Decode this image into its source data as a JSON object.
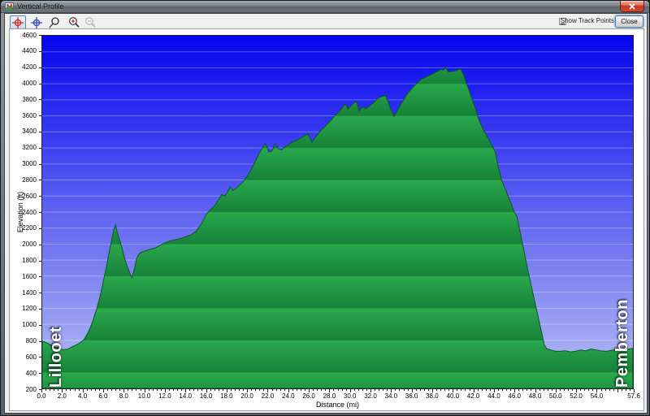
{
  "window": {
    "title": "Vertical Profile"
  },
  "icons": {
    "window_close_glyph": "x",
    "toolbar": [
      {
        "name": "track-pan-red-icon",
        "selected": true,
        "enabled": true
      },
      {
        "name": "track-pan-blue-icon",
        "selected": false,
        "enabled": true
      },
      {
        "name": "lasso-select-icon",
        "selected": false,
        "enabled": true
      },
      {
        "name": "zoom-in-icon",
        "selected": false,
        "enabled": true
      },
      {
        "name": "zoom-out-icon",
        "selected": false,
        "enabled": false
      }
    ]
  },
  "controls": {
    "show_track_points_prefix": "S",
    "show_track_points_rest": "how Track Points",
    "show_track_points_checked": false,
    "close_label": "Close"
  },
  "chart_data": {
    "type": "area",
    "xlabel": "Distance  (mi)",
    "ylabel": "Elevation (ft)",
    "xlim": [
      0,
      57.6
    ],
    "ylim": [
      200,
      4600
    ],
    "x_tick_step": 2.0,
    "x_minor_tick_step": 0.4,
    "x_final_tick": 57.6,
    "x_skipped_tick_labels": [
      56.0
    ],
    "y_tick_step": 200,
    "grid": "horizontal-only",
    "start_label": "Lillooet",
    "end_label": "Pemberton",
    "colors": {
      "sky_top": "#0505f0",
      "sky_bottom": "#b9c1f3",
      "gridline": "rgba(255,255,255,0.32)",
      "terrain_light": "#2aa94c",
      "terrain_dark": "#178139",
      "terrain_outline": "#0d5624",
      "band_height_ft": 400
    },
    "series": [
      {
        "name": "elevation_profile",
        "points": [
          [
            0.0,
            790
          ],
          [
            0.4,
            770
          ],
          [
            0.8,
            745
          ],
          [
            1.2,
            720
          ],
          [
            1.6,
            700
          ],
          [
            2.0,
            682
          ],
          [
            2.4,
            688
          ],
          [
            2.8,
            710
          ],
          [
            3.2,
            735
          ],
          [
            3.6,
            762
          ],
          [
            3.9,
            790
          ],
          [
            4.1,
            815
          ],
          [
            4.4,
            880
          ],
          [
            4.7,
            960
          ],
          [
            5.0,
            1070
          ],
          [
            5.3,
            1190
          ],
          [
            5.6,
            1330
          ],
          [
            5.9,
            1500
          ],
          [
            6.2,
            1690
          ],
          [
            6.5,
            1880
          ],
          [
            6.8,
            2070
          ],
          [
            7.0,
            2190
          ],
          [
            7.15,
            2245
          ],
          [
            7.3,
            2150
          ],
          [
            7.6,
            2030
          ],
          [
            7.9,
            1890
          ],
          [
            8.2,
            1750
          ],
          [
            8.5,
            1650
          ],
          [
            8.75,
            1585
          ],
          [
            9.0,
            1700
          ],
          [
            9.2,
            1820
          ],
          [
            9.45,
            1880
          ],
          [
            9.7,
            1900
          ],
          [
            10.0,
            1915
          ],
          [
            10.5,
            1935
          ],
          [
            11.0,
            1950
          ],
          [
            11.5,
            1985
          ],
          [
            12.0,
            2020
          ],
          [
            12.5,
            2040
          ],
          [
            13.0,
            2055
          ],
          [
            13.5,
            2070
          ],
          [
            14.0,
            2095
          ],
          [
            14.5,
            2115
          ],
          [
            15.0,
            2160
          ],
          [
            15.5,
            2250
          ],
          [
            16.0,
            2370
          ],
          [
            16.4,
            2430
          ],
          [
            16.8,
            2475
          ],
          [
            17.2,
            2555
          ],
          [
            17.5,
            2620
          ],
          [
            17.8,
            2600
          ],
          [
            18.1,
            2660
          ],
          [
            18.35,
            2715
          ],
          [
            18.6,
            2670
          ],
          [
            18.9,
            2695
          ],
          [
            19.2,
            2730
          ],
          [
            19.6,
            2780
          ],
          [
            20.0,
            2850
          ],
          [
            20.4,
            2935
          ],
          [
            20.8,
            3040
          ],
          [
            21.2,
            3140
          ],
          [
            21.6,
            3230
          ],
          [
            21.8,
            3250
          ],
          [
            22.1,
            3150
          ],
          [
            22.4,
            3160
          ],
          [
            22.7,
            3255
          ],
          [
            23.0,
            3190
          ],
          [
            23.3,
            3175
          ],
          [
            23.7,
            3215
          ],
          [
            24.1,
            3250
          ],
          [
            24.5,
            3280
          ],
          [
            25.0,
            3310
          ],
          [
            25.5,
            3345
          ],
          [
            25.9,
            3375
          ],
          [
            26.3,
            3270
          ],
          [
            26.7,
            3340
          ],
          [
            27.1,
            3410
          ],
          [
            27.5,
            3460
          ],
          [
            28.0,
            3525
          ],
          [
            28.5,
            3595
          ],
          [
            29.0,
            3660
          ],
          [
            29.4,
            3725
          ],
          [
            29.6,
            3750
          ],
          [
            29.8,
            3685
          ],
          [
            30.1,
            3725
          ],
          [
            30.4,
            3760
          ],
          [
            30.65,
            3780
          ],
          [
            30.9,
            3660
          ],
          [
            31.2,
            3715
          ],
          [
            31.5,
            3690
          ],
          [
            31.9,
            3720
          ],
          [
            32.3,
            3765
          ],
          [
            32.8,
            3825
          ],
          [
            33.2,
            3845
          ],
          [
            33.5,
            3855
          ],
          [
            33.9,
            3710
          ],
          [
            34.3,
            3595
          ],
          [
            34.7,
            3685
          ],
          [
            35.1,
            3770
          ],
          [
            35.5,
            3855
          ],
          [
            36.0,
            3935
          ],
          [
            36.5,
            4005
          ],
          [
            37.0,
            4060
          ],
          [
            37.5,
            4090
          ],
          [
            38.0,
            4120
          ],
          [
            38.5,
            4155
          ],
          [
            38.9,
            4180
          ],
          [
            39.1,
            4170
          ],
          [
            39.3,
            4205
          ],
          [
            39.6,
            4150
          ],
          [
            40.0,
            4155
          ],
          [
            40.4,
            4165
          ],
          [
            40.8,
            4185
          ],
          [
            41.1,
            4110
          ],
          [
            41.4,
            3990
          ],
          [
            41.8,
            3855
          ],
          [
            42.2,
            3705
          ],
          [
            42.6,
            3545
          ],
          [
            43.0,
            3430
          ],
          [
            43.4,
            3340
          ],
          [
            43.8,
            3250
          ],
          [
            44.2,
            3140
          ],
          [
            44.5,
            2950
          ],
          [
            44.8,
            2800
          ],
          [
            45.2,
            2670
          ],
          [
            45.6,
            2545
          ],
          [
            46.0,
            2410
          ],
          [
            46.3,
            2340
          ],
          [
            46.6,
            2150
          ],
          [
            46.9,
            1960
          ],
          [
            47.2,
            1770
          ],
          [
            47.5,
            1590
          ],
          [
            47.8,
            1410
          ],
          [
            48.1,
            1240
          ],
          [
            48.4,
            1065
          ],
          [
            48.7,
            895
          ],
          [
            48.95,
            745
          ],
          [
            49.2,
            695
          ],
          [
            49.6,
            678
          ],
          [
            50.0,
            665
          ],
          [
            50.5,
            662
          ],
          [
            51.0,
            670
          ],
          [
            51.5,
            655
          ],
          [
            52.0,
            662
          ],
          [
            52.5,
            678
          ],
          [
            53.0,
            668
          ],
          [
            53.5,
            690
          ],
          [
            54.0,
            680
          ],
          [
            54.5,
            668
          ],
          [
            55.0,
            662
          ],
          [
            55.5,
            674
          ],
          [
            56.0,
            684
          ],
          [
            56.5,
            672
          ],
          [
            57.0,
            686
          ],
          [
            57.3,
            692
          ],
          [
            57.6,
            700
          ]
        ]
      }
    ]
  }
}
